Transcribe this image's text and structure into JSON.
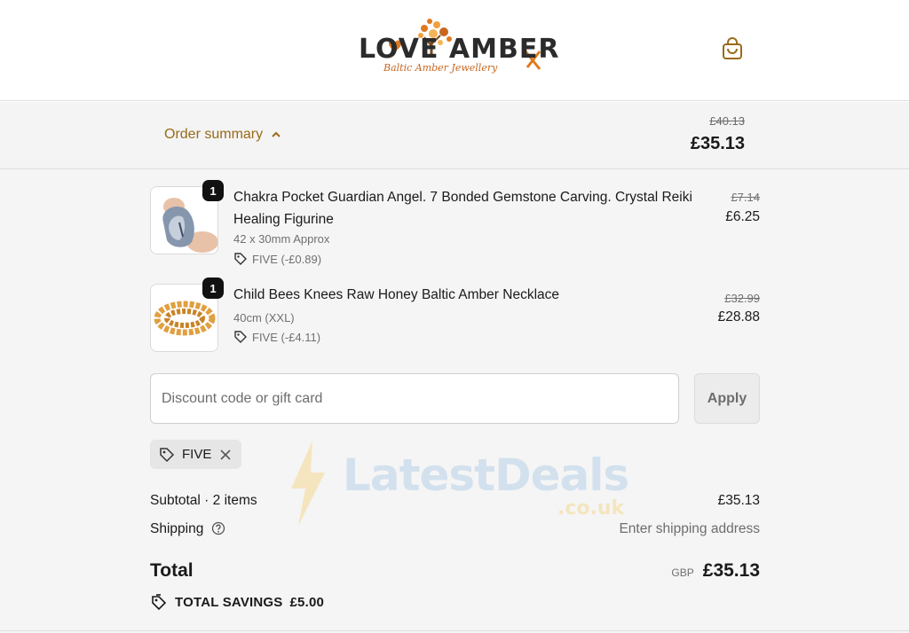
{
  "brand": {
    "logo_word": "LOVE AMBER",
    "logo_tagline": "Baltic Amber Jewellery"
  },
  "summary": {
    "toggle_label": "Order summary",
    "original_total": "£40.13",
    "total": "£35.13"
  },
  "items": [
    {
      "quantity": "1",
      "title": "Chakra Pocket Guardian Angel. 7 Bonded Gemstone Carving. Crystal Reiki Healing Figurine",
      "variant": "42 x 30mm Approx",
      "discount": "FIVE (-£0.89)",
      "original_price": "£7.14",
      "price": "£6.25"
    },
    {
      "quantity": "1",
      "title": "Child Bees Knees Raw Honey Baltic Amber Necklace",
      "variant": "40cm (XXL)",
      "discount": "FIVE (-£4.11)",
      "original_price": "£32.99",
      "price": "£28.88"
    }
  ],
  "discount_form": {
    "placeholder": "Discount code or gift card",
    "value": "",
    "apply_label": "Apply"
  },
  "applied_code": "FIVE",
  "totals": {
    "subtotal_label": "Subtotal · 2 items",
    "subtotal_value": "£35.13",
    "shipping_label": "Shipping",
    "shipping_value": "Enter shipping address",
    "total_label": "Total",
    "currency": "GBP",
    "total_value": "£35.13",
    "savings_label": "TOTAL SAVINGS",
    "savings_value": "£5.00"
  },
  "watermark": {
    "text": "LatestDeals",
    "sub": ".co.uk"
  },
  "colors": {
    "accent": "#9a6a18",
    "logo_orange": "#e07a1f",
    "band_bg": "#f4f4f4",
    "text": "#1a1a1a",
    "muted": "#707070"
  },
  "icons": {
    "cart": "shopping-bag-icon",
    "toggle": "chevron-up-icon",
    "discount_tag": "tag-icon",
    "remove": "close-icon",
    "help": "question-circle-icon",
    "savings": "double-tag-icon"
  }
}
